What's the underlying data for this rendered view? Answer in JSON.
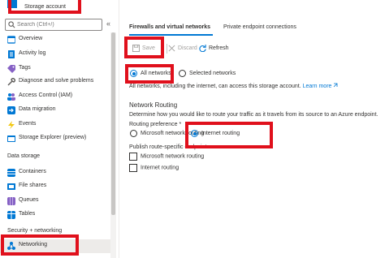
{
  "sidebar": {
    "resource_type": "Storage account",
    "search_placeholder": "Search (Ctrl+/)",
    "collapse_glyph": "«",
    "items": [
      {
        "label": "Overview",
        "icon": "overview-icon",
        "color": "#0078d4"
      },
      {
        "label": "Activity log",
        "icon": "activity-log-icon",
        "color": "#0078d4"
      },
      {
        "label": "Tags",
        "icon": "tag-icon",
        "color": "#8661c5"
      },
      {
        "label": "Diagnose and solve problems",
        "icon": "wrench-icon",
        "color": "#605e5c"
      },
      {
        "label": "Access Control (IAM)",
        "icon": "people-icon",
        "color": "#0078d4"
      },
      {
        "label": "Data migration",
        "icon": "migration-icon",
        "color": "#0078d4"
      },
      {
        "label": "Events",
        "icon": "lightning-icon",
        "color": "#f2c811"
      },
      {
        "label": "Storage Explorer (preview)",
        "icon": "explorer-icon",
        "color": "#0078d4"
      }
    ],
    "data_storage_header": "Data storage",
    "data_storage_items": [
      {
        "label": "Containers",
        "icon": "containers-icon",
        "color": "#0078d4"
      },
      {
        "label": "File shares",
        "icon": "file-shares-icon",
        "color": "#0078d4"
      },
      {
        "label": "Queues",
        "icon": "queues-icon",
        "color": "#8661c5"
      },
      {
        "label": "Tables",
        "icon": "tables-icon",
        "color": "#0078d4"
      }
    ],
    "security_header": "Security + networking",
    "networking_label": "Networking"
  },
  "main": {
    "tabs": [
      {
        "label": "Firewalls and virtual networks"
      },
      {
        "label": "Private endpoint connections"
      }
    ],
    "toolbar": {
      "save": "Save",
      "discard": "Discard",
      "refresh": "Refresh"
    },
    "allow_access": {
      "option_all": "All networks",
      "option_selected": "Selected networks",
      "info_text": "All networks, including the internet, can access this storage account.",
      "learn_more": "Learn more"
    },
    "network_routing": {
      "title": "Network Routing",
      "description": "Determine how you would like to route your traffic as it travels from its source to an Azure endpoint.",
      "preference_label": "Routing preference *",
      "option_microsoft": "Microsoft network routing",
      "option_internet": "Internet routing",
      "publish_label": "Publish route-specific endpoints",
      "publish_microsoft": "Microsoft network routing",
      "publish_internet": "Internet routing"
    }
  },
  "colors": {
    "accent": "#0078d4",
    "annotation": "#e0101c"
  }
}
